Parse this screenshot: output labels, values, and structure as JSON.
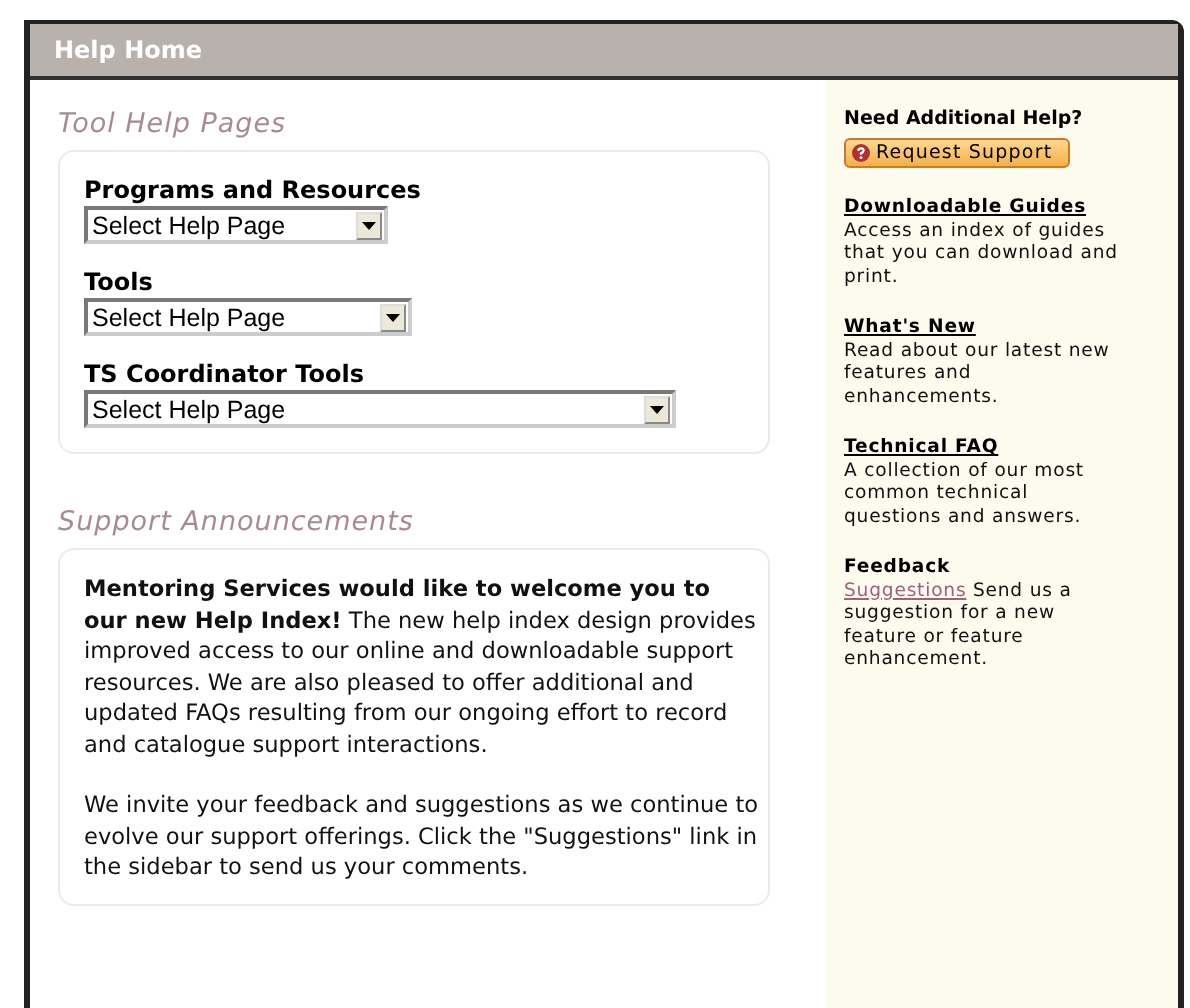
{
  "window": {
    "title": "Help Home"
  },
  "tool_help": {
    "heading": "Tool Help Pages",
    "selects": [
      {
        "label": "Programs and Resources",
        "value": "Select Help Page"
      },
      {
        "label": "Tools",
        "value": "Select Help Page"
      },
      {
        "label": "TS Coordinator Tools",
        "value": "Select Help Page"
      }
    ]
  },
  "announcements": {
    "heading": "Support Announcements",
    "paragraphs": [
      "**Mentoring Services would like to welcome you to our new Help Index!** The new help index design provides improved access to our online and downloadable support resources. We are also pleased to offer additional and updated FAQs resulting from our ongoing effort to record and catalogue support interactions.",
      "We invite your feedback and suggestions as we continue to evolve our support offerings. Click the \"Suggestions\" link in the sidebar to send us your comments."
    ]
  },
  "sidebar": {
    "heading": "Need Additional Help?",
    "button": "Request Support",
    "sections": [
      {
        "title": "Downloadable Guides",
        "title_link": true,
        "text": "Access an index of guides that you can download and print."
      },
      {
        "title": "What's New",
        "title_link": true,
        "text": "Read about our latest new features and enhancements."
      },
      {
        "title": "Technical FAQ",
        "title_link": true,
        "text": "A collection of our most common technical questions and answers."
      },
      {
        "title": "Feedback",
        "title_link": false,
        "link": "Suggestions",
        "text": "Send us a suggestion for a new feature or feature enhancement."
      }
    ]
  }
}
